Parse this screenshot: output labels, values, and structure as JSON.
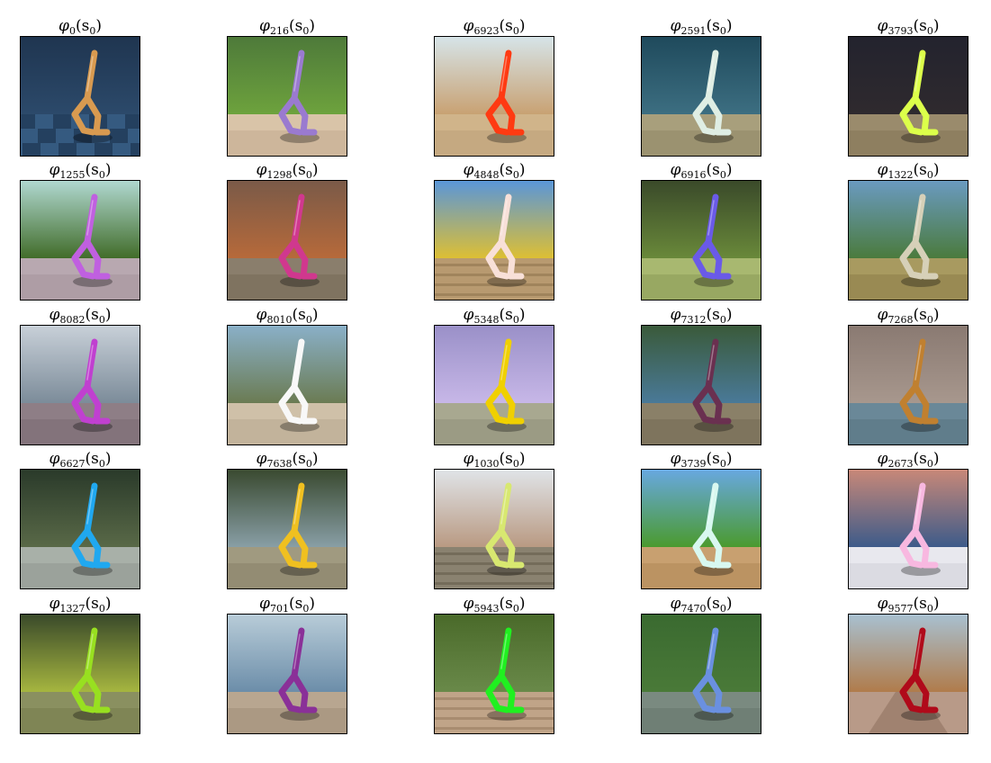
{
  "panels": [
    {
      "title": {
        "phi": "φ",
        "sub": "0",
        "arg": "(s",
        "argsub": "0",
        "close": ")"
      },
      "colors": {
        "bg_top": "#1f3550",
        "bg_bottom": "#2c4a6b",
        "floor": "#355a80",
        "floor_alt": "#24405f",
        "walker": "#d89a50"
      },
      "floor_type": "checker"
    },
    {
      "title": {
        "phi": "φ",
        "sub": "216",
        "arg": "(s",
        "argsub": "0",
        "close": ")"
      },
      "colors": {
        "bg_top": "#4e7a3a",
        "bg_bottom": "#6ea33d",
        "floor": "#d9c4a8",
        "floor_alt": "#c2ac90",
        "walker": "#9a7ad0"
      },
      "floor_type": "plain"
    },
    {
      "title": {
        "phi": "φ",
        "sub": "6923",
        "arg": "(s",
        "argsub": "0",
        "close": ")"
      },
      "colors": {
        "bg_top": "#d6e4e8",
        "bg_bottom": "#c8a070",
        "floor": "#d0b48a",
        "floor_alt": "#bba07a",
        "walker": "#ff3a12"
      },
      "floor_type": "plain"
    },
    {
      "title": {
        "phi": "φ",
        "sub": "2591",
        "arg": "(s",
        "argsub": "0",
        "close": ")"
      },
      "colors": {
        "bg_top": "#1f4a5c",
        "bg_bottom": "#3d6f82",
        "floor": "#a89f7c",
        "floor_alt": "#8f8766",
        "walker": "#dfeee4"
      },
      "floor_type": "plain"
    },
    {
      "title": {
        "phi": "φ",
        "sub": "3793",
        "arg": "(s",
        "argsub": "0",
        "close": ")"
      },
      "colors": {
        "bg_top": "#23232e",
        "bg_bottom": "#2f2a2e",
        "floor": "#9a8b6c",
        "floor_alt": "#857758",
        "walker": "#dcff4a"
      },
      "floor_type": "plain"
    },
    {
      "title": {
        "phi": "φ",
        "sub": "1255",
        "arg": "(s",
        "argsub": "0",
        "close": ")"
      },
      "colors": {
        "bg_top": "#b0d8d0",
        "bg_bottom": "#3f6a26",
        "floor": "#b8a8b0",
        "floor_alt": "#a5949d",
        "walker": "#c060e0"
      },
      "floor_type": "plain"
    },
    {
      "title": {
        "phi": "φ",
        "sub": "1298",
        "arg": "(s",
        "argsub": "0",
        "close": ")"
      },
      "colors": {
        "bg_top": "#7a5a48",
        "bg_bottom": "#b86a3a",
        "floor": "#8a7e6c",
        "floor_alt": "#766a58",
        "walker": "#d0388e"
      },
      "floor_type": "plain"
    },
    {
      "title": {
        "phi": "φ",
        "sub": "4848",
        "arg": "(s",
        "argsub": "0",
        "close": ")"
      },
      "colors": {
        "bg_top": "#5a96d8",
        "bg_bottom": "#e0c030",
        "floor": "#b89a70",
        "floor_alt": "#a0845c",
        "walker": "#f8e0d8"
      },
      "floor_type": "plank"
    },
    {
      "title": {
        "phi": "φ",
        "sub": "6916",
        "arg": "(s",
        "argsub": "0",
        "close": ")"
      },
      "colors": {
        "bg_top": "#3a4a2a",
        "bg_bottom": "#6a8a3a",
        "floor": "#a8b870",
        "floor_alt": "#8a9a58",
        "walker": "#6a5ae8"
      },
      "floor_type": "plain"
    },
    {
      "title": {
        "phi": "φ",
        "sub": "1322",
        "arg": "(s",
        "argsub": "0",
        "close": ")"
      },
      "colors": {
        "bg_top": "#6a9ac0",
        "bg_bottom": "#4a7a3a",
        "floor": "#a89a60",
        "floor_alt": "#8c7e48",
        "walker": "#d6d0b8"
      },
      "floor_type": "plain"
    },
    {
      "title": {
        "phi": "φ",
        "sub": "8082",
        "arg": "(s",
        "argsub": "0",
        "close": ")"
      },
      "colors": {
        "bg_top": "#c8d0d8",
        "bg_bottom": "#7a8a98",
        "floor": "#8e7e86",
        "floor_alt": "#7a6a72",
        "walker": "#c040d0"
      },
      "floor_type": "plain"
    },
    {
      "title": {
        "phi": "φ",
        "sub": "8010",
        "arg": "(s",
        "argsub": "0",
        "close": ")"
      },
      "colors": {
        "bg_top": "#8ab0c8",
        "bg_bottom": "#6a7a50",
        "floor": "#cfc0a8",
        "floor_alt": "#b8a890",
        "walker": "#f8f8f8"
      },
      "floor_type": "plain"
    },
    {
      "title": {
        "phi": "φ",
        "sub": "5348",
        "arg": "(s",
        "argsub": "0",
        "close": ")"
      },
      "colors": {
        "bg_top": "#9a90c8",
        "bg_bottom": "#c8b8e8",
        "floor": "#a8a890",
        "floor_alt": "#90907a",
        "walker": "#f0d000"
      },
      "floor_type": "plain"
    },
    {
      "title": {
        "phi": "φ",
        "sub": "7312",
        "arg": "(s",
        "argsub": "0",
        "close": ")"
      },
      "colors": {
        "bg_top": "#3a5a3a",
        "bg_bottom": "#4a7a9a",
        "floor": "#8a8068",
        "floor_alt": "#746a54",
        "walker": "#6a3050"
      },
      "floor_type": "plain"
    },
    {
      "title": {
        "phi": "φ",
        "sub": "7268",
        "arg": "(s",
        "argsub": "0",
        "close": ")"
      },
      "colors": {
        "bg_top": "#8a7a72",
        "bg_bottom": "#a8988e",
        "floor": "#6a8898",
        "floor_alt": "#587482",
        "walker": "#c08030"
      },
      "floor_type": "plain"
    },
    {
      "title": {
        "phi": "φ",
        "sub": "6627",
        "arg": "(s",
        "argsub": "0",
        "close": ")"
      },
      "colors": {
        "bg_top": "#2a3a2a",
        "bg_bottom": "#5a6a48",
        "floor": "#a8b0a8",
        "floor_alt": "#909890",
        "walker": "#20a8f0"
      },
      "floor_type": "plain"
    },
    {
      "title": {
        "phi": "φ",
        "sub": "7638",
        "arg": "(s",
        "argsub": "0",
        "close": ")"
      },
      "colors": {
        "bg_top": "#3a4a30",
        "bg_bottom": "#8aa0a8",
        "floor": "#a09a80",
        "floor_alt": "#888268",
        "walker": "#f0c020"
      },
      "floor_type": "plain"
    },
    {
      "title": {
        "phi": "φ",
        "sub": "1030",
        "arg": "(s",
        "argsub": "0",
        "close": ")"
      },
      "colors": {
        "bg_top": "#e0e4e8",
        "bg_bottom": "#b89880",
        "floor": "#8a8270",
        "floor_alt": "#746c5a",
        "walker": "#d8e870"
      },
      "floor_type": "plank"
    },
    {
      "title": {
        "phi": "φ",
        "sub": "3739",
        "arg": "(s",
        "argsub": "0",
        "close": ")"
      },
      "colors": {
        "bg_top": "#68a8e0",
        "bg_bottom": "#4a9a2a",
        "floor": "#c8a070",
        "floor_alt": "#b08858",
        "walker": "#d8f8f0"
      },
      "floor_type": "plain"
    },
    {
      "title": {
        "phi": "φ",
        "sub": "2673",
        "arg": "(s",
        "argsub": "0",
        "close": ")"
      },
      "colors": {
        "bg_top": "#c88878",
        "bg_bottom": "#3a5a8a",
        "floor": "#e8e8ee",
        "floor_alt": "#d0d0d8",
        "walker": "#f8b8e0"
      },
      "floor_type": "plain"
    },
    {
      "title": {
        "phi": "φ",
        "sub": "1327",
        "arg": "(s",
        "argsub": "0",
        "close": ")"
      },
      "colors": {
        "bg_top": "#3a4a2a",
        "bg_bottom": "#a8b840",
        "floor": "#8a9060",
        "floor_alt": "#767c4c",
        "walker": "#98e020"
      },
      "floor_type": "plain"
    },
    {
      "title": {
        "phi": "φ",
        "sub": "701",
        "arg": "(s",
        "argsub": "0",
        "close": ")"
      },
      "colors": {
        "bg_top": "#b8ccd8",
        "bg_bottom": "#6a8ca8",
        "floor": "#b8a690",
        "floor_alt": "#a08e78",
        "walker": "#8a3098"
      },
      "floor_type": "plain"
    },
    {
      "title": {
        "phi": "φ",
        "sub": "5943",
        "arg": "(s",
        "argsub": "0",
        "close": ")"
      },
      "colors": {
        "bg_top": "#4a6a2a",
        "bg_bottom": "#6a8a4a",
        "floor": "#c0a488",
        "floor_alt": "#a88c70",
        "walker": "#20f020"
      },
      "floor_type": "plank"
    },
    {
      "title": {
        "phi": "φ",
        "sub": "7470",
        "arg": "(s",
        "argsub": "0",
        "close": ")"
      },
      "colors": {
        "bg_top": "#3a6a30",
        "bg_bottom": "#4a7a38",
        "floor": "#7a8a80",
        "floor_alt": "#66766c",
        "walker": "#6a90e0"
      },
      "floor_type": "plain"
    },
    {
      "title": {
        "phi": "φ",
        "sub": "9577",
        "arg": "(s",
        "argsub": "0",
        "close": ")"
      },
      "colors": {
        "bg_top": "#a8c0d0",
        "bg_bottom": "#b07a48",
        "floor": "#b89a88",
        "floor_alt": "#a08270",
        "walker": "#b00a1a"
      },
      "floor_type": "road"
    }
  ]
}
